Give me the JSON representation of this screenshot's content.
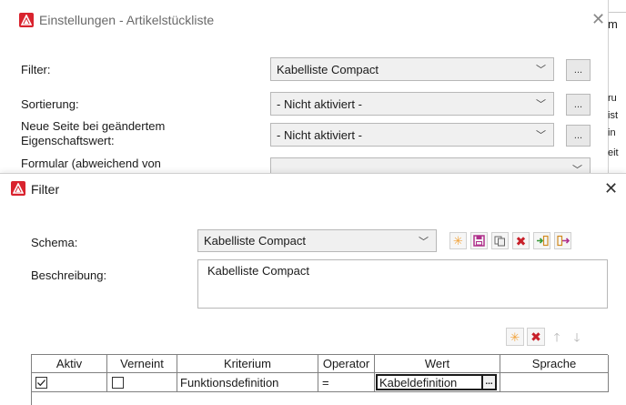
{
  "background_window": {
    "title": "Einstellungen - Artikelstückliste",
    "fields": [
      {
        "label": "Filter:",
        "value": "Kabelliste Compact",
        "button": "..."
      },
      {
        "label": "Sortierung:",
        "value": "- Nicht aktiviert -",
        "button": "..."
      },
      {
        "label": "Neue Seite bei geändertem Eigenschaftswert:",
        "value": "- Nicht aktiviert -",
        "button": "..."
      },
      {
        "label": "Formular (abweichend von",
        "value": ""
      }
    ],
    "right_edge_fragments": [
      "m",
      "ru",
      "ist",
      "in",
      "eit"
    ]
  },
  "filter_dialog": {
    "title": "Filter",
    "schema_label": "Schema:",
    "schema_value": "Kabelliste Compact",
    "description_label": "Beschreibung:",
    "description_value": "Kabelliste Compact",
    "table": {
      "columns": [
        "Aktiv",
        "Verneint",
        "Kriterium",
        "Operator",
        "Wert",
        "Sprache"
      ],
      "rows": [
        {
          "aktiv": true,
          "verneint": false,
          "kriterium": "Funktionsdefinition",
          "operator": "=",
          "wert": "Kabeldefinition",
          "wert_button": "...",
          "sprache": ""
        }
      ]
    }
  },
  "icons": {
    "new": "sun-icon",
    "save": "floppy-icon",
    "copy": "copy-icon",
    "delete": "red-x-icon",
    "import": "import-icon",
    "export": "export-icon",
    "up": "arrow-up-icon",
    "down": "arrow-down-icon"
  },
  "colors": {
    "brand_red": "#d9232e",
    "delete_red": "#c8202a",
    "star_orange": "#f2a33a",
    "save_magenta": "#b0308c"
  }
}
